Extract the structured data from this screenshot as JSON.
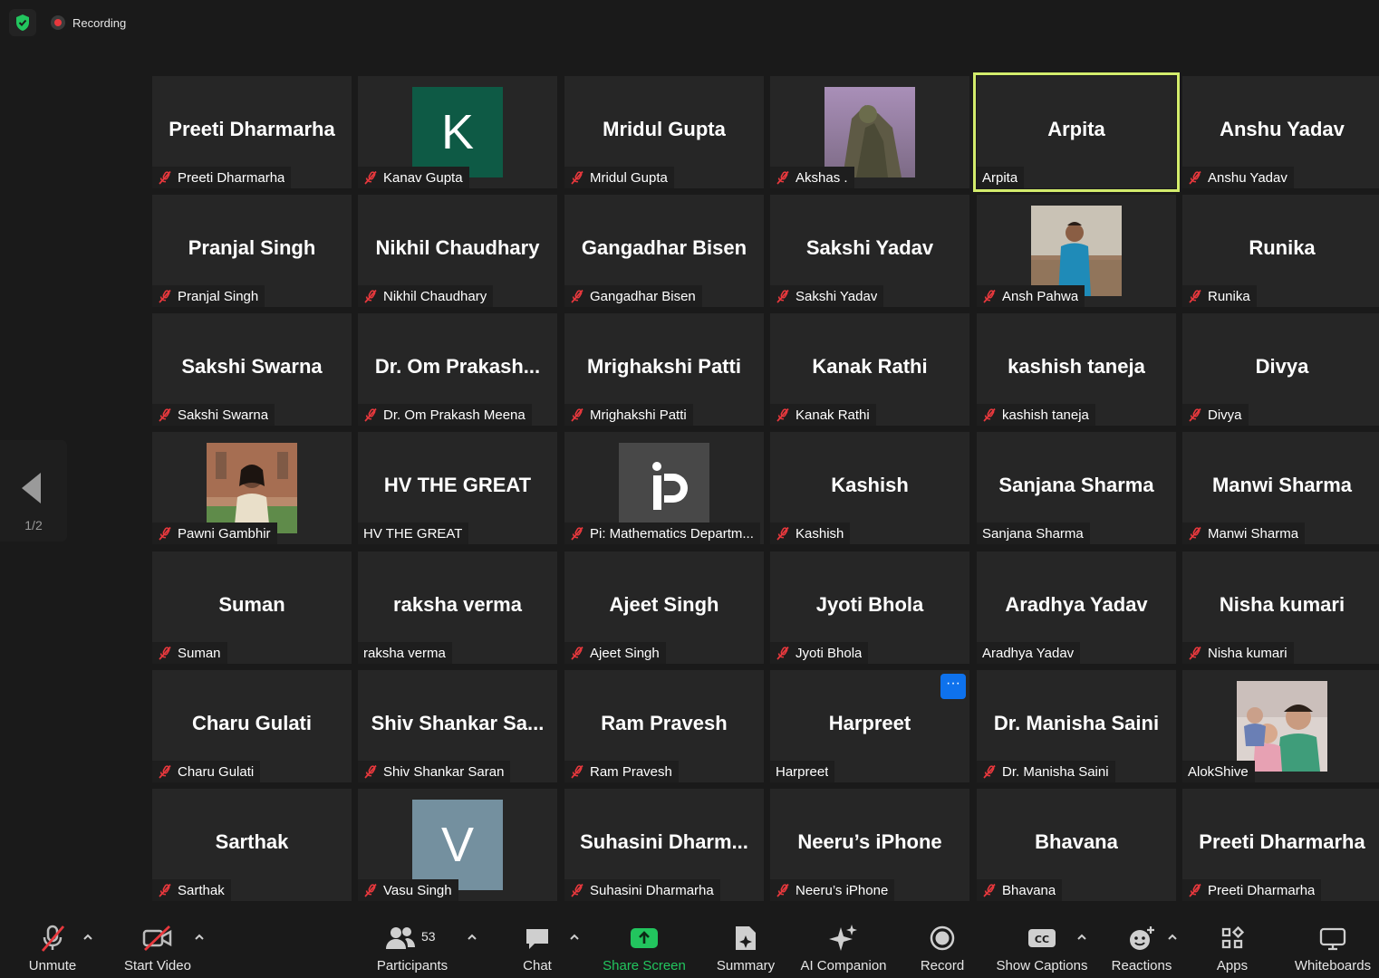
{
  "meeting": {
    "recording_label": "Recording",
    "page_indicator": "1/2"
  },
  "tiles": [
    {
      "big": "Preeti Dharmarha",
      "name": "Preeti Dharmarha",
      "muted": true
    },
    {
      "avatar_letter": "K",
      "avatar_color": "#0e5a45",
      "name": "Kanav Gupta",
      "muted": true
    },
    {
      "big": "Mridul Gupta",
      "name": "Mridul Gupta",
      "muted": true
    },
    {
      "photo": "landscape",
      "name": "Akshas .",
      "muted": true
    },
    {
      "big": "Arpita",
      "name": "Arpita",
      "muted": false,
      "active_speaker": true
    },
    {
      "big": "Anshu Yadav",
      "name": "Anshu Yadav",
      "muted": true
    },
    {
      "big": "Pranjal Singh",
      "name": "Pranjal Singh",
      "muted": true
    },
    {
      "big": "Nikhil Chaudhary",
      "name": "Nikhil Chaudhary",
      "muted": true
    },
    {
      "big": "Gangadhar Bisen",
      "name": "Gangadhar Bisen",
      "muted": true
    },
    {
      "big": "Sakshi Yadav",
      "name": "Sakshi Yadav",
      "muted": true
    },
    {
      "photo": "man",
      "name": "Ansh Pahwa",
      "muted": true
    },
    {
      "big": "Runika",
      "name": "Runika",
      "muted": true
    },
    {
      "big": "Sakshi Swarna",
      "name": "Sakshi Swarna",
      "muted": true
    },
    {
      "big": "Dr. Om Prakash...",
      "name": "Dr. Om Prakash Meena",
      "muted": true
    },
    {
      "big": "Mrighakshi Patti",
      "name": "Mrighakshi Patti",
      "muted": true
    },
    {
      "big": "Kanak Rathi",
      "name": "Kanak Rathi",
      "muted": true
    },
    {
      "big": "kashish taneja",
      "name": "kashish taneja",
      "muted": true
    },
    {
      "big": "Divya",
      "name": "Divya",
      "muted": true
    },
    {
      "photo": "woman",
      "name": "Pawni Gambhir",
      "muted": true
    },
    {
      "big": "HV THE GREAT",
      "name": "HV THE GREAT",
      "muted": false
    },
    {
      "photo": "logo",
      "name": "Pi: Mathematics Departm...",
      "muted": true
    },
    {
      "big": "Kashish",
      "name": "Kashish",
      "muted": true
    },
    {
      "big": "Sanjana Sharma",
      "name": "Sanjana Sharma",
      "muted": false
    },
    {
      "big": "Manwi Sharma",
      "name": "Manwi Sharma",
      "muted": true
    },
    {
      "big": "Suman",
      "name": "Suman",
      "muted": true
    },
    {
      "big": "raksha verma",
      "name": "raksha verma",
      "muted": false
    },
    {
      "big": "Ajeet Singh",
      "name": "Ajeet Singh",
      "muted": true
    },
    {
      "big": "Jyoti Bhola",
      "name": "Jyoti Bhola",
      "muted": true
    },
    {
      "big": "Aradhya Yadav",
      "name": "Aradhya Yadav",
      "muted": false
    },
    {
      "big": "Nisha kumari",
      "name": "Nisha kumari",
      "muted": true
    },
    {
      "big": "Charu Gulati",
      "name": "Charu Gulati",
      "muted": true
    },
    {
      "big": "Shiv Shankar Sa...",
      "name": "Shiv Shankar Saran",
      "muted": true
    },
    {
      "big": "Ram Pravesh",
      "name": "Ram Pravesh",
      "muted": true
    },
    {
      "big": "Harpreet",
      "name": "Harpreet",
      "muted": false,
      "more_button": "···"
    },
    {
      "big": "Dr. Manisha Saini",
      "name": "Dr. Manisha Saini",
      "muted": true
    },
    {
      "photo": "group",
      "name": "AlokShive",
      "muted": false
    },
    {
      "big": "Sarthak",
      "name": "Sarthak",
      "muted": true
    },
    {
      "avatar_letter": "V",
      "avatar_color": "#74909f",
      "name": "Vasu Singh",
      "muted": true
    },
    {
      "big": "Suhasini  Dharm...",
      "name": "Suhasini Dharmarha",
      "muted": true
    },
    {
      "big": "Neeru’s iPhone",
      "name": "Neeru’s iPhone",
      "muted": true
    },
    {
      "big": "Bhavana",
      "name": "Bhavana",
      "muted": true
    },
    {
      "big": "Preeti Dharmarha",
      "name": "Preeti Dharmarha",
      "muted": true
    }
  ],
  "toolbar": {
    "unmute": "Unmute",
    "start_video": "Start Video",
    "participants": "Participants",
    "participants_count": "53",
    "chat": "Chat",
    "share_screen": "Share Screen",
    "summary": "Summary",
    "ai_companion": "AI Companion",
    "record": "Record",
    "show_captions": "Show Captions",
    "reactions": "Reactions",
    "apps": "Apps",
    "whiteboards": "Whiteboards"
  },
  "colors": {
    "active_border": "#d3ec6c",
    "share_green": "#22c55e",
    "mute_red": "#e8383d",
    "more_blue": "#0e72ed"
  }
}
